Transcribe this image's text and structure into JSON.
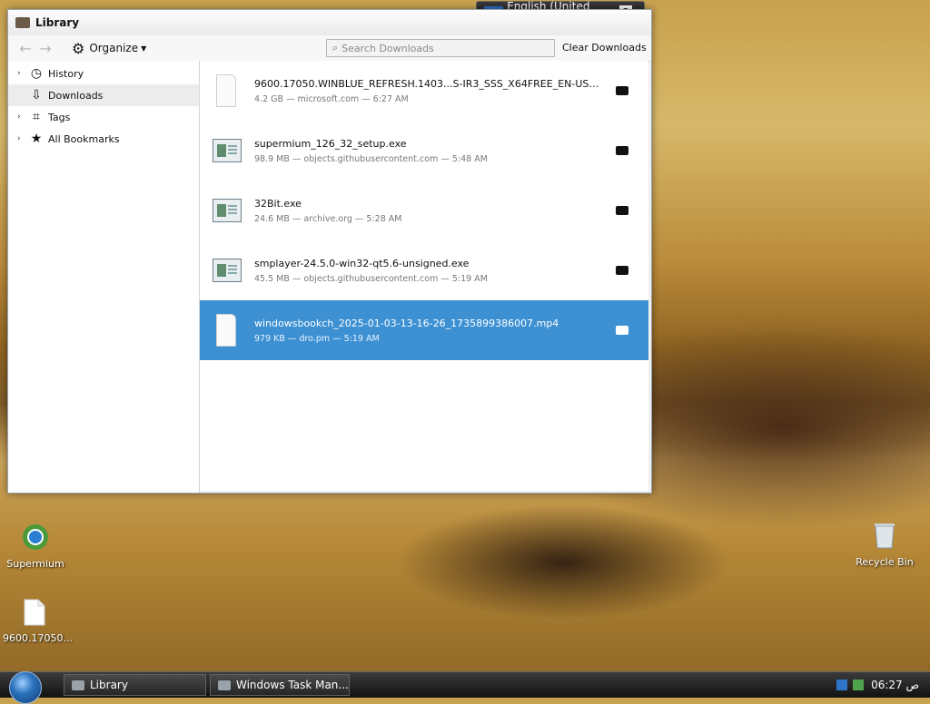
{
  "language_bar": {
    "code": "EN",
    "language": "English (United States)",
    "help": "?"
  },
  "window": {
    "title": "Library",
    "toolbar": {
      "organize": "Organize",
      "search_placeholder": "Search Downloads",
      "clear_downloads": "Clear Downloads"
    },
    "sidebar": {
      "items": [
        {
          "label": "History",
          "icon": "clock-icon"
        },
        {
          "label": "Downloads",
          "icon": "download-icon"
        },
        {
          "label": "Tags",
          "icon": "tag-icon"
        },
        {
          "label": "All Bookmarks",
          "icon": "star-icon"
        }
      ]
    },
    "downloads": [
      {
        "name": "9600.17050.WINBLUE_REFRESH.1403...S-IR3_SSS_X64FREE_EN-US_DV9.ISO",
        "meta": "4.2 GB — microsoft.com — 6:27 AM",
        "icon": "document-icon"
      },
      {
        "name": "supermium_126_32_setup.exe",
        "meta": "98.9 MB — objects.githubusercontent.com — 5:48 AM",
        "icon": "exe-icon"
      },
      {
        "name": "32Bit.exe",
        "meta": "24.6 MB — archive.org — 5:28 AM",
        "icon": "exe-icon"
      },
      {
        "name": "smplayer-24.5.0-win32-qt5.6-unsigned.exe",
        "meta": "45.5 MB — objects.githubusercontent.com — 5:19 AM",
        "icon": "exe-icon"
      },
      {
        "name": "windowsbookch_2025-01-03-13-16-26_1735899386007.mp4",
        "meta": "979 KB — dro.pm — 5:19 AM",
        "icon": "document-icon"
      }
    ]
  },
  "desktop": {
    "icons": [
      {
        "label": "Supermium",
        "icon": "supermium-icon"
      },
      {
        "label": "9600.17050...",
        "icon": "file-icon"
      },
      {
        "label": "Recycle Bin",
        "icon": "recycle-bin-icon"
      }
    ]
  },
  "taskbar": {
    "buttons": [
      {
        "label": "Library",
        "icon": "library-icon"
      },
      {
        "label": "Windows Task Man...",
        "icon": "task-manager-icon"
      }
    ],
    "clock": "06:27 ص"
  },
  "colors": {
    "selection": "#3d91d3",
    "taskbar": "#1c1c1c"
  }
}
